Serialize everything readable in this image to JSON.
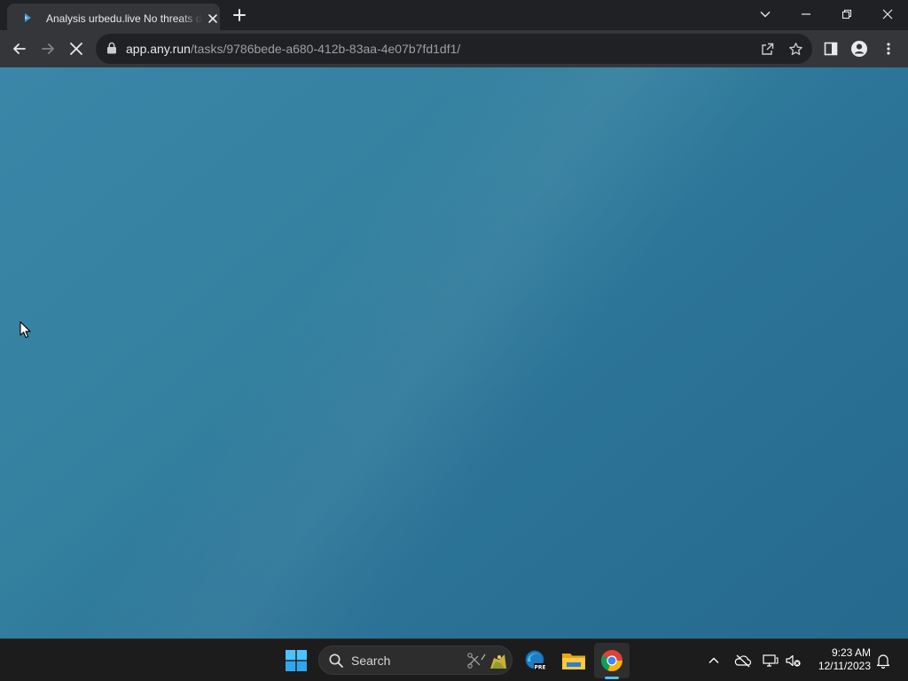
{
  "browser": {
    "tab": {
      "title": "Analysis urbedu.live No threats detected",
      "favicon": "anyrun-favicon-icon"
    },
    "address_bar": {
      "host": "app.any.run",
      "path": "/tasks/9786bede-a680-412b-83aa-4e07b7fd1df1/"
    },
    "loading": true
  },
  "desktop": {
    "background_color": "#2a7095"
  },
  "taskbar": {
    "search": {
      "label": "Search"
    },
    "pinned_apps": [
      "start-icon",
      "edge-beta-icon",
      "file-explorer-icon",
      "chrome-icon"
    ],
    "active_app": "chrome-icon",
    "clock": {
      "time": "9:23 AM",
      "date": "12/11/2023"
    }
  }
}
